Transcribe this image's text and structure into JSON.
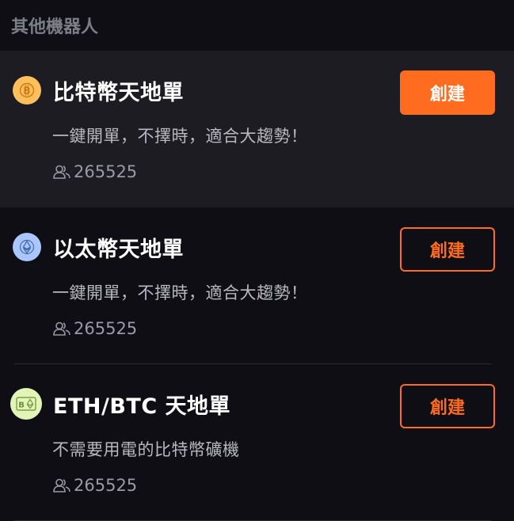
{
  "section": {
    "title": "其他機器人"
  },
  "colors": {
    "accent": "#ff6b1f",
    "btc": "#ffbf5c",
    "eth": "#a9c6ff",
    "ethbtc": "#e2f4b6"
  },
  "robots": [
    {
      "icon": "bitcoin-icon",
      "title": "比特幣天地單",
      "description": "一鍵開單，不擇時，適合大趨勢！",
      "users": "265525",
      "button": "創建"
    },
    {
      "icon": "ethereum-icon",
      "title": "以太幣天地單",
      "description": "一鍵開單，不擇時，適合大趨勢！",
      "users": "265525",
      "button": "創建"
    },
    {
      "icon": "eth-btc-icon",
      "title": "ETH/BTC 天地單",
      "description": "不需要用電的比特幣礦機",
      "users": "265525",
      "button": "創建"
    }
  ]
}
